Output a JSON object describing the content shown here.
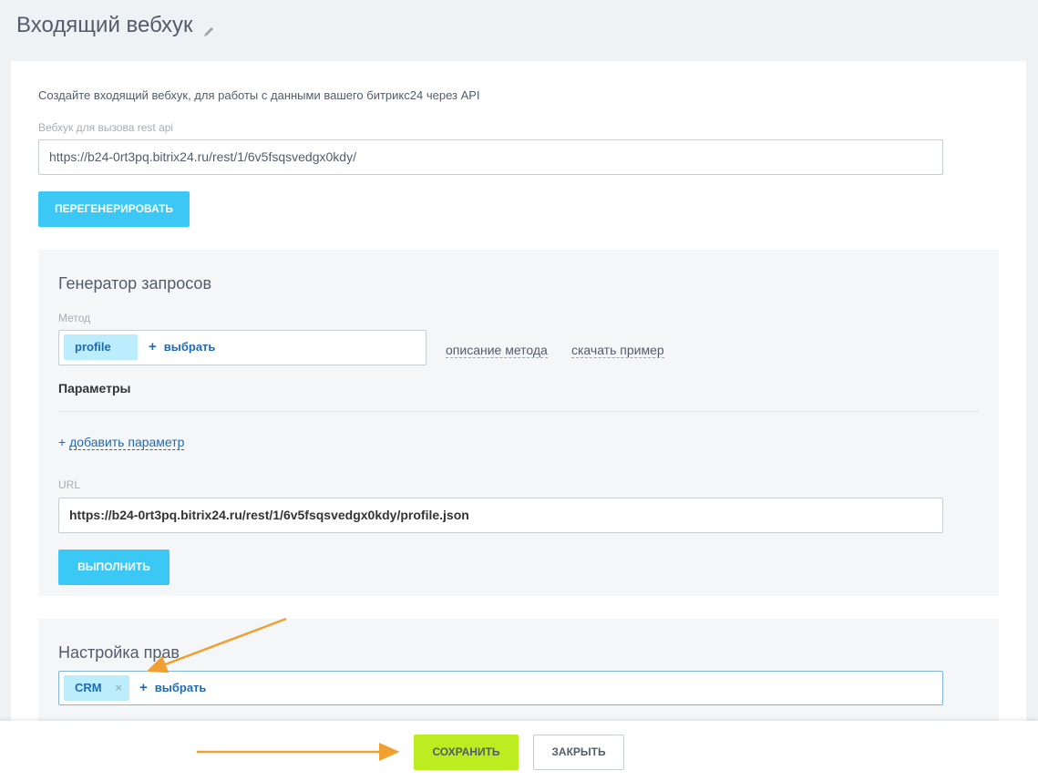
{
  "page": {
    "title": "Входящий вебхук"
  },
  "webhook": {
    "intro": "Создайте входящий вебхук, для работы с данными вашего битрикс24 через API",
    "url_label": "Вебхук для вызова rest api",
    "url_value": "https://b24-0rt3pq.bitrix24.ru/rest/1/6v5fsqsvedgx0kdy/",
    "regenerate_label": "ПЕРЕГЕНЕРИРОВАТЬ"
  },
  "generator": {
    "title": "Генератор запросов",
    "method_label": "Метод",
    "method_tag": "profile",
    "select_label": "выбрать",
    "method_description_link": "описание метода",
    "download_example_link": "скачать пример",
    "params_title": "Параметры",
    "add_param_link": "добавить параметр",
    "url_label": "URL",
    "url_value": "https://b24-0rt3pq.bitrix24.ru/rest/1/6v5fsqsvedgx0kdy/profile.json",
    "execute_label": "ВЫПОЛНИТЬ"
  },
  "rights": {
    "title": "Настройка прав",
    "tag": "CRM",
    "tag_remove": "×",
    "select_label": "выбрать"
  },
  "footer": {
    "save_label": "СОХРАНИТЬ",
    "close_label": "ЗАКРЫТЬ"
  },
  "colors": {
    "accent_blue": "#3bc8f5",
    "save_green": "#bbed21",
    "annotation_arrow": "#f0a030"
  }
}
